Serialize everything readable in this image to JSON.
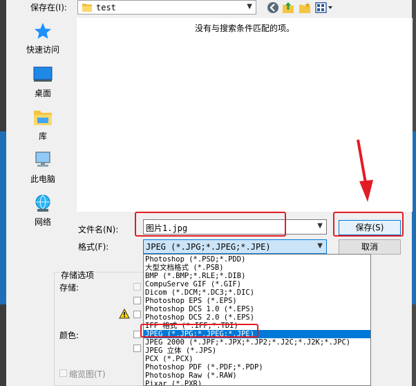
{
  "dialog": {
    "save_in_label": "保存在(I):",
    "save_in_value": "test",
    "empty_message": "没有与搜索条件匹配的项。",
    "filename_label": "文件名(N):",
    "filename_value": "图片1.jpg",
    "format_label": "格式(F):",
    "format_value": "JPEG (*.JPG;*.JPEG;*.JPE)",
    "save_button": "保存(S)",
    "cancel_button": "取消"
  },
  "places": [
    {
      "label": "快速访问",
      "icon": "star-icon"
    },
    {
      "label": "桌面",
      "icon": "desktop-icon"
    },
    {
      "label": "库",
      "icon": "library-icon"
    },
    {
      "label": "此电脑",
      "icon": "computer-icon"
    },
    {
      "label": "网络",
      "icon": "network-icon"
    }
  ],
  "options": {
    "group_title": "存储选项",
    "store_label": "存储:",
    "color_label": "颜色:",
    "thumbnail_label": "缩览图(T)"
  },
  "format_list": [
    "Photoshop (*.PSD;*.PDD)",
    "大型文档格式 (*.PSB)",
    "BMP (*.BMP;*.RLE;*.DIB)",
    "CompuServe GIF (*.GIF)",
    "Dicom (*.DCM;*.DC3;*.DIC)",
    "Photoshop EPS (*.EPS)",
    "Photoshop DCS 1.0 (*.EPS)",
    "Photoshop DCS 2.0 (*.EPS)",
    "IFF 格式 (*.IFF;*.TDI)",
    "JPEG (*.JPG;*.JPEG;*.JPE)",
    "JPEG 2000 (*.JPF;*.JPX;*.JP2;*.J2C;*.J2K;*.JPC)",
    "JPEG 立体 (*.JPS)",
    "PCX (*.PCX)",
    "Photoshop PDF (*.PDF;*.PDP)",
    "Photoshop Raw (*.RAW)",
    "Pixar (*.PXR)"
  ],
  "selected_format_index": 9,
  "colors": {
    "accent": "#0078d7",
    "highlight": "#e31b23",
    "selection_bg": "#cce4f7"
  }
}
